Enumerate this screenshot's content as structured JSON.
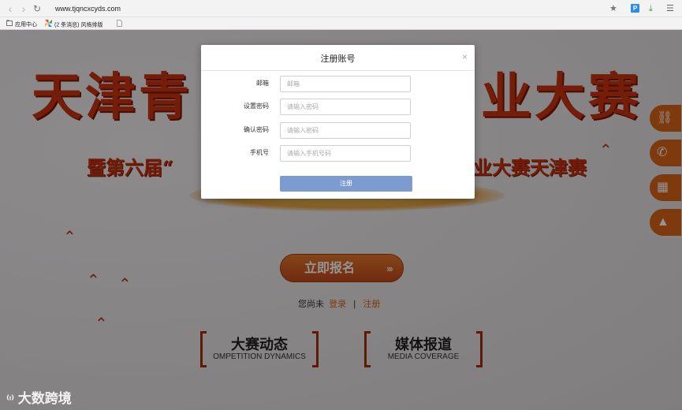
{
  "browser": {
    "url": "www.tjqncxcyds.com",
    "bookmarks": [
      {
        "label": "应用中心"
      },
      {
        "label": "(2 条消息) 风格排版"
      }
    ]
  },
  "page": {
    "hero_title_left": "天津青",
    "hero_title_right": "业大赛",
    "hero_sub_left": "暨第六届“",
    "hero_sub_right": "业大赛天津赛",
    "register_cta": "立即报名",
    "login_prompt": "您尚未",
    "login_link": "登录",
    "divider": "|",
    "register_link": "注册",
    "sections": [
      {
        "zh": "大赛动态",
        "en": "OMPETITION  DYNAMICS"
      },
      {
        "zh": "媒体报道",
        "en": "MEDIA COVERAGE"
      }
    ],
    "watermark": "大数跨境",
    "side_icons": [
      "link-icon",
      "phone-icon",
      "qrcode-icon",
      "top-arrow-icon"
    ]
  },
  "modal": {
    "title": "注册账号",
    "close": "×",
    "fields": [
      {
        "label": "邮箱",
        "placeholder": "邮箱"
      },
      {
        "label": "设置密码",
        "placeholder": "请输入密码"
      },
      {
        "label": "确认密码",
        "placeholder": "请输入密码"
      },
      {
        "label": "手机号",
        "placeholder": "请输入手机号码"
      }
    ],
    "submit": "注册"
  },
  "colors": {
    "accent": "#d96218",
    "title_red": "#c8320f",
    "submit_button": "#7c9bd0"
  }
}
